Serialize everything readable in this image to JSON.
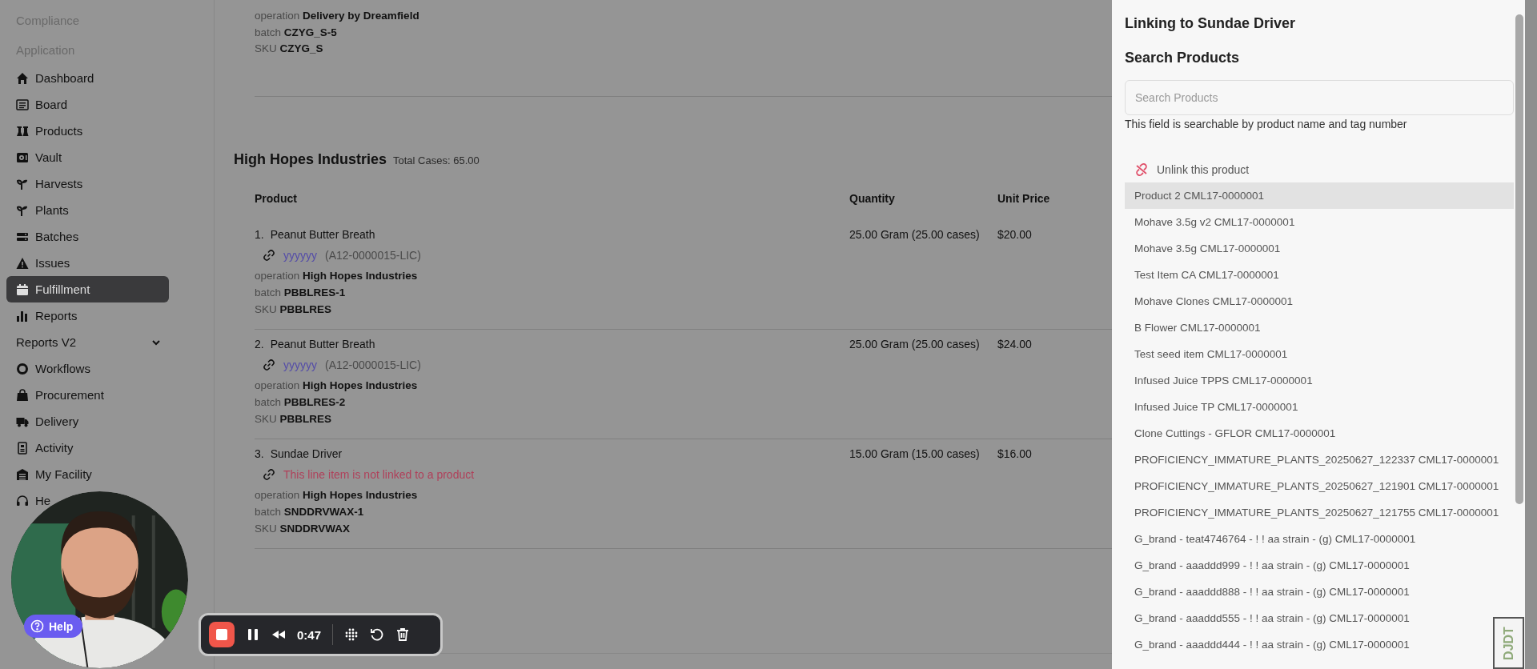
{
  "sidebar": {
    "headings": [
      "Compliance",
      "Application"
    ],
    "items": [
      {
        "label": "Dashboard",
        "kind": "link",
        "selected": false
      },
      {
        "label": "Board",
        "kind": "link",
        "selected": false
      },
      {
        "label": "Products",
        "kind": "link",
        "selected": false
      },
      {
        "label": "Vault",
        "kind": "link",
        "selected": false
      },
      {
        "label": "Harvests",
        "kind": "link",
        "selected": false
      },
      {
        "label": "Plants",
        "kind": "link",
        "selected": false
      },
      {
        "label": "Batches",
        "kind": "link",
        "selected": false
      },
      {
        "label": "Issues",
        "kind": "link",
        "selected": false
      },
      {
        "label": "Fulfillment",
        "kind": "link",
        "selected": true
      },
      {
        "label": "Reports",
        "kind": "link",
        "selected": false
      },
      {
        "label": "Reports V2",
        "kind": "group",
        "selected": false
      },
      {
        "label": "Workflows",
        "kind": "link",
        "selected": false
      },
      {
        "label": "Procurement",
        "kind": "link",
        "selected": false
      },
      {
        "label": "Delivery",
        "kind": "link",
        "selected": false
      },
      {
        "label": "Activity",
        "kind": "link",
        "selected": false
      },
      {
        "label": "My Facility",
        "kind": "link",
        "selected": false
      },
      {
        "label": "He",
        "kind": "link",
        "selected": false
      }
    ]
  },
  "previous_order": {
    "fields": [
      {
        "label": "operation",
        "value": "Delivery by Dreamfield"
      },
      {
        "label": "batch",
        "value": "CZYG_S-5"
      },
      {
        "label": "SKU",
        "value": "CZYG_S"
      }
    ]
  },
  "order": {
    "title": "High Hopes Industries",
    "total": "Total Cases: 65.00",
    "columns": [
      "Product",
      "Quantity",
      "Unit Price"
    ],
    "rows": [
      {
        "number": "1.",
        "name": "Peanut Butter Breath",
        "linked": true,
        "link_name": "yyyyyy",
        "link_tag": "(A12-0000015-LIC)",
        "quantity": "25.00 Gram (25.00 cases)",
        "unit_price": "$20.00",
        "fields": [
          {
            "label": "operation",
            "value": "High Hopes Industries"
          },
          {
            "label": "batch",
            "value": "PBBLRES-1"
          },
          {
            "label": "SKU",
            "value": "PBBLRES"
          }
        ]
      },
      {
        "number": "2.",
        "name": "Peanut Butter Breath",
        "linked": true,
        "link_name": "yyyyyy",
        "link_tag": "(A12-0000015-LIC)",
        "quantity": "25.00 Gram (25.00 cases)",
        "unit_price": "$24.00",
        "fields": [
          {
            "label": "operation",
            "value": "High Hopes Industries"
          },
          {
            "label": "batch",
            "value": "PBBLRES-2"
          },
          {
            "label": "SKU",
            "value": "PBBLRES"
          }
        ]
      },
      {
        "number": "3.",
        "name": "Sundae Driver",
        "linked": false,
        "link_message": "This line item is not linked to a product",
        "quantity": "15.00 Gram (15.00 cases)",
        "unit_price": "$16.00",
        "fields": [
          {
            "label": "operation",
            "value": "High Hopes Industries"
          },
          {
            "label": "batch",
            "value": "SNDDRVWAX-1"
          },
          {
            "label": "SKU",
            "value": "SNDDRVWAX"
          }
        ]
      }
    ]
  },
  "panel": {
    "title": "Linking to Sundae Driver",
    "heading": "Search Products",
    "search": {
      "placeholder": "Search Products"
    },
    "hint": "This field is searchable by product name and tag number",
    "unlink": "Unlink this product",
    "results": [
      {
        "label": "Product 2 CML17-0000001",
        "selected": true
      },
      {
        "label": "Mohave 3.5g v2 CML17-0000001",
        "selected": false
      },
      {
        "label": "Mohave 3.5g CML17-0000001",
        "selected": false
      },
      {
        "label": "Test Item CA CML17-0000001",
        "selected": false
      },
      {
        "label": "Mohave Clones CML17-0000001",
        "selected": false
      },
      {
        "label": "B Flower CML17-0000001",
        "selected": false
      },
      {
        "label": "Test seed item CML17-0000001",
        "selected": false
      },
      {
        "label": "Infused Juice TPPS CML17-0000001",
        "selected": false
      },
      {
        "label": "Infused Juice TP CML17-0000001",
        "selected": false
      },
      {
        "label": "Clone Cuttings - GFLOR CML17-0000001",
        "selected": false
      },
      {
        "label": "PROFICIENCY_IMMATURE_PLANTS_20250627_122337 CML17-0000001",
        "selected": false
      },
      {
        "label": "PROFICIENCY_IMMATURE_PLANTS_20250627_121901 CML17-0000001",
        "selected": false
      },
      {
        "label": "PROFICIENCY_IMMATURE_PLANTS_20250627_121755 CML17-0000001",
        "selected": false
      },
      {
        "label": "G_brand - teat4746764 - ! ! aa strain - (g) CML17-0000001",
        "selected": false
      },
      {
        "label": "G_brand - aaaddd999 - ! ! aa strain - (g) CML17-0000001",
        "selected": false
      },
      {
        "label": "G_brand - aaaddd888 - ! ! aa strain - (g) CML17-0000001",
        "selected": false
      },
      {
        "label": "G_brand - aaaddd555 - ! ! aa strain - (g) CML17-0000001",
        "selected": false
      },
      {
        "label": "G_brand - aaaddd444 - ! ! aa strain - (g) CML17-0000001",
        "selected": false
      }
    ]
  },
  "help_button": "Help",
  "recorder": {
    "time": "0:47"
  },
  "debug_toolbar": "DJDT"
}
